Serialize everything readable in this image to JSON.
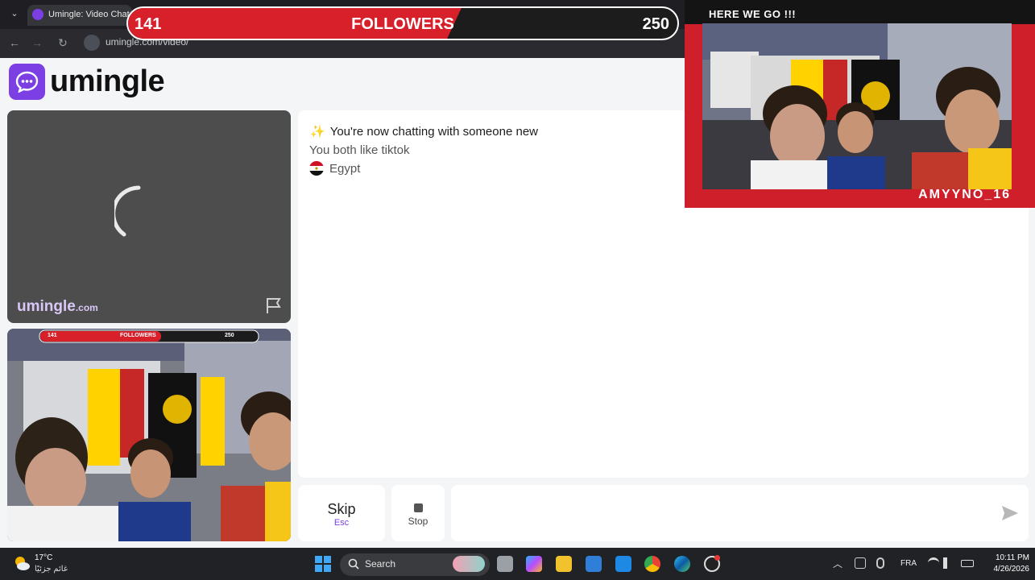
{
  "browser": {
    "tab_title": "Umingle: Video Chat w",
    "url": "umingle.com/video/"
  },
  "stream_banner": {
    "current": "141",
    "label": "FOLLOWERS",
    "goal": "250",
    "progress_fraction": 0.564,
    "colors": {
      "fill": "#d8202a",
      "track": "#1c1c1c"
    }
  },
  "app": {
    "name": "umingle",
    "accent": "#7b3fe4"
  },
  "stranger_video": {
    "brand_name": "umingle",
    "brand_suffix": ".com",
    "state": "loading"
  },
  "self_video": {
    "mini_banner_current": "141",
    "mini_banner_label": "FOLLOWERS",
    "mini_banner_goal": "250"
  },
  "chat": {
    "message_icon": "sparkles-icon",
    "message": "You're now chatting with someone new",
    "shared_interest": "You both like tiktok",
    "country": "Egypt",
    "country_flag": "egypt-flag-icon"
  },
  "controls": {
    "skip_label": "Skip",
    "skip_key": "Esc",
    "stop_label": "Stop",
    "message_placeholder": "",
    "send_icon": "send-icon"
  },
  "stream_overlay": {
    "title": "HERE WE GO !!!",
    "username": "AMYYNO_16",
    "accent": "#cf1f2a"
  },
  "taskbar": {
    "weather_temp": "17°C",
    "weather_desc": "غائم جزئيًا",
    "search_label": "Search",
    "language": "FRA",
    "time": "10:11 PM",
    "date": "4/26/2026"
  }
}
